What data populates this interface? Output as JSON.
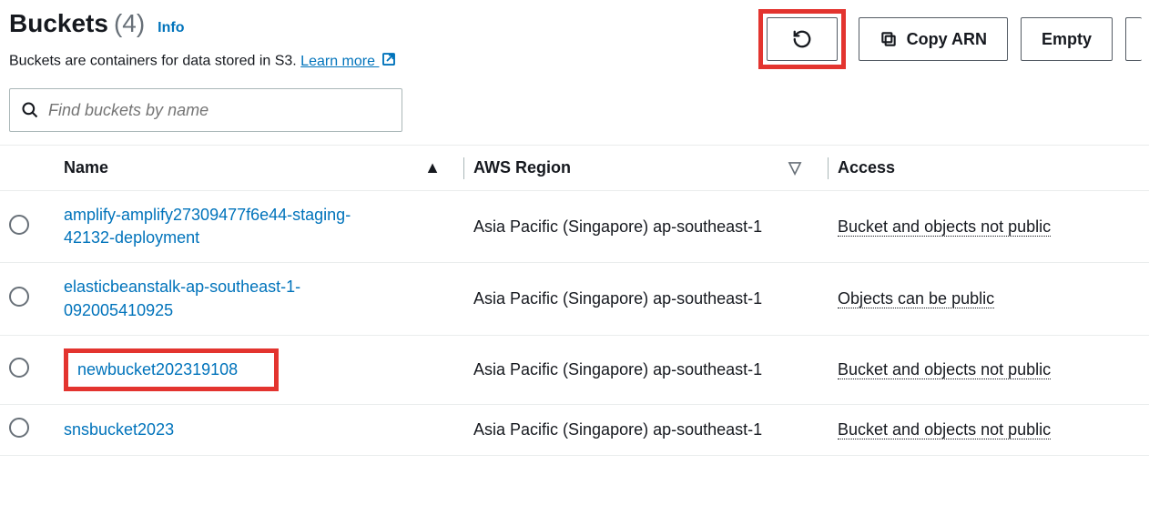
{
  "title": {
    "text": "Buckets",
    "count": "(4)",
    "info": "Info"
  },
  "description": {
    "text": "Buckets are containers for data stored in S3. ",
    "learn_more": "Learn more"
  },
  "buttons": {
    "refresh": "Refresh",
    "copy_arn": "Copy ARN",
    "empty": "Empty"
  },
  "search": {
    "placeholder": "Find buckets by name"
  },
  "columns": {
    "name": "Name",
    "region": "AWS Region",
    "access": "Access"
  },
  "rows": [
    {
      "name": "amplify-amplify27309477f6e44-staging-42132-deployment",
      "region": "Asia Pacific (Singapore) ap-southeast-1",
      "access": "Bucket and objects not public",
      "highlight": false
    },
    {
      "name": "elasticbeanstalk-ap-southeast-1-092005410925",
      "region": "Asia Pacific (Singapore) ap-southeast-1",
      "access": "Objects can be public",
      "highlight": false
    },
    {
      "name": "newbucket202319108",
      "region": "Asia Pacific (Singapore) ap-southeast-1",
      "access": "Bucket and objects not public",
      "highlight": true
    },
    {
      "name": "snsbucket2023",
      "region": "Asia Pacific (Singapore) ap-southeast-1",
      "access": "Bucket and objects not public",
      "highlight": false
    }
  ]
}
